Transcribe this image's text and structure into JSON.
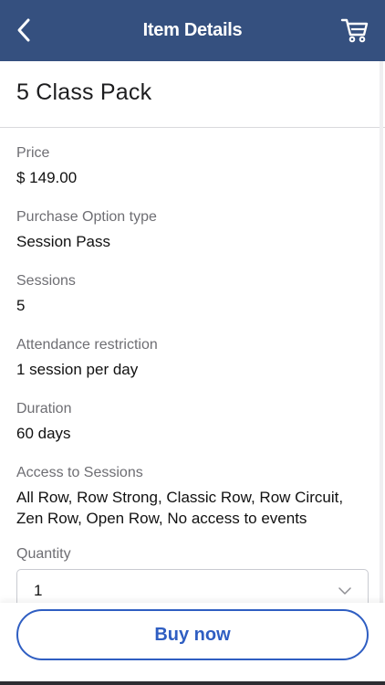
{
  "header": {
    "title": "Item Details",
    "back_icon": "chevron-left-icon",
    "cart_icon": "cart-icon",
    "background": "#35507f"
  },
  "product": {
    "name": "5 Class Pack"
  },
  "details": [
    {
      "label": "Price",
      "value": "$ 149.00"
    },
    {
      "label": "Purchase Option type",
      "value": "Session Pass"
    },
    {
      "label": "Sessions",
      "value": "5"
    },
    {
      "label": "Attendance restriction",
      "value": "1 session per day"
    },
    {
      "label": "Duration",
      "value": "60 days"
    },
    {
      "label": "Access to Sessions",
      "value": "All Row, Row Strong, Classic Row, Row Circuit, Zen Row, Open Row, No access to events"
    }
  ],
  "quantity": {
    "label": "Quantity",
    "value": "1",
    "icon": "chevron-down-icon"
  },
  "footer": {
    "buy_label": "Buy now",
    "accent": "#2f5ec2"
  }
}
